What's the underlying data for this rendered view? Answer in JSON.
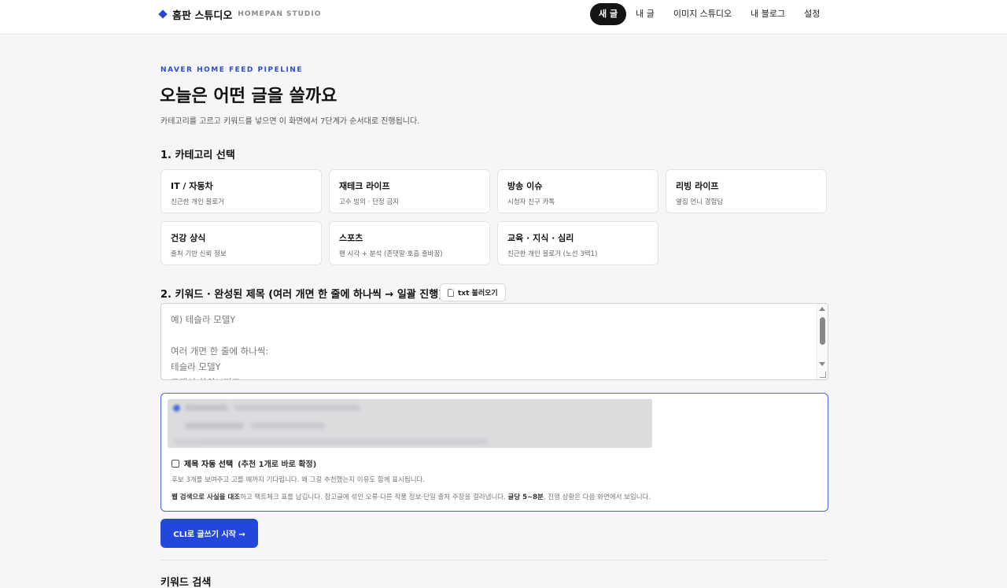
{
  "header": {
    "brand_name": "홈판 스튜디오",
    "brand_sub": "HOMEPAN STUDIO",
    "nav": [
      {
        "label": "새 글",
        "active": true
      },
      {
        "label": "내 글"
      },
      {
        "label": "이미지 스튜디오"
      },
      {
        "label": "내 블로그"
      },
      {
        "label": "설정"
      }
    ]
  },
  "main": {
    "eyebrow": "NAVER HOME FEED PIPELINE",
    "title": "오늘은 어떤 글을 쓸까요",
    "description": "카테고리를 고르고 키워드를 넣으면 이 화면에서 7단계가 순서대로 진행됩니다."
  },
  "category": {
    "heading": "1. 카테고리 선택",
    "items": [
      {
        "name": "IT / 자동차",
        "sub": "친근한 개인 블로거"
      },
      {
        "name": "재테크 라이프",
        "sub": "고수 빙의 · 단정 금지"
      },
      {
        "name": "방송 이슈",
        "sub": "시청자 친구 카톡"
      },
      {
        "name": "리빙 라이프",
        "sub": "옆집 언니 경험담"
      },
      {
        "name": "건강 상식",
        "sub": "출처 기반 신뢰 정보"
      },
      {
        "name": "스포츠",
        "sub": "팬 시각 + 분석 (존댓말·호흡 출바꿈)"
      },
      {
        "name": "교육 · 지식 · 심리",
        "sub": "친근한 개인 블로거 (노선 3택1)"
      }
    ]
  },
  "keyword": {
    "heading": "2. 키워드 · 완성된 제목 (여러 개면 한 줄에 하나씩 → 일괄 진행)",
    "txt_button": "txt 불러오기",
    "placeholder": "예) 테슬라 모델Y\n\n여러 개면 한 줄에 하나씩:\n테슬라 모델Y\n그래서 하이브리드"
  },
  "options": {
    "auto_label": "제목 자동 선택",
    "auto_paren": "(추천 1개로 바로 확정)",
    "note1": "후보 3개를 보여주고 고를 때까지 기다립니다. 왜 그걸 추천했는지 이유도 함께 표시됩니다.",
    "note2_bold_a": "웹 검색으로 사실을 대조",
    "note2_mid": "하고 팩트체크 표를 남깁니다. 참고글에 섞인 오류·다른 작품 정보·단일 출처 주장을 걸러냅니다.",
    "note2_bold_b": "글당 5~8분",
    "note2_end": ", 진행 상황은 다음 화면에서 보입니다."
  },
  "start_button": "CLI로 글쓰기 시작 →",
  "keyword_search_heading": "키워드 검색"
}
